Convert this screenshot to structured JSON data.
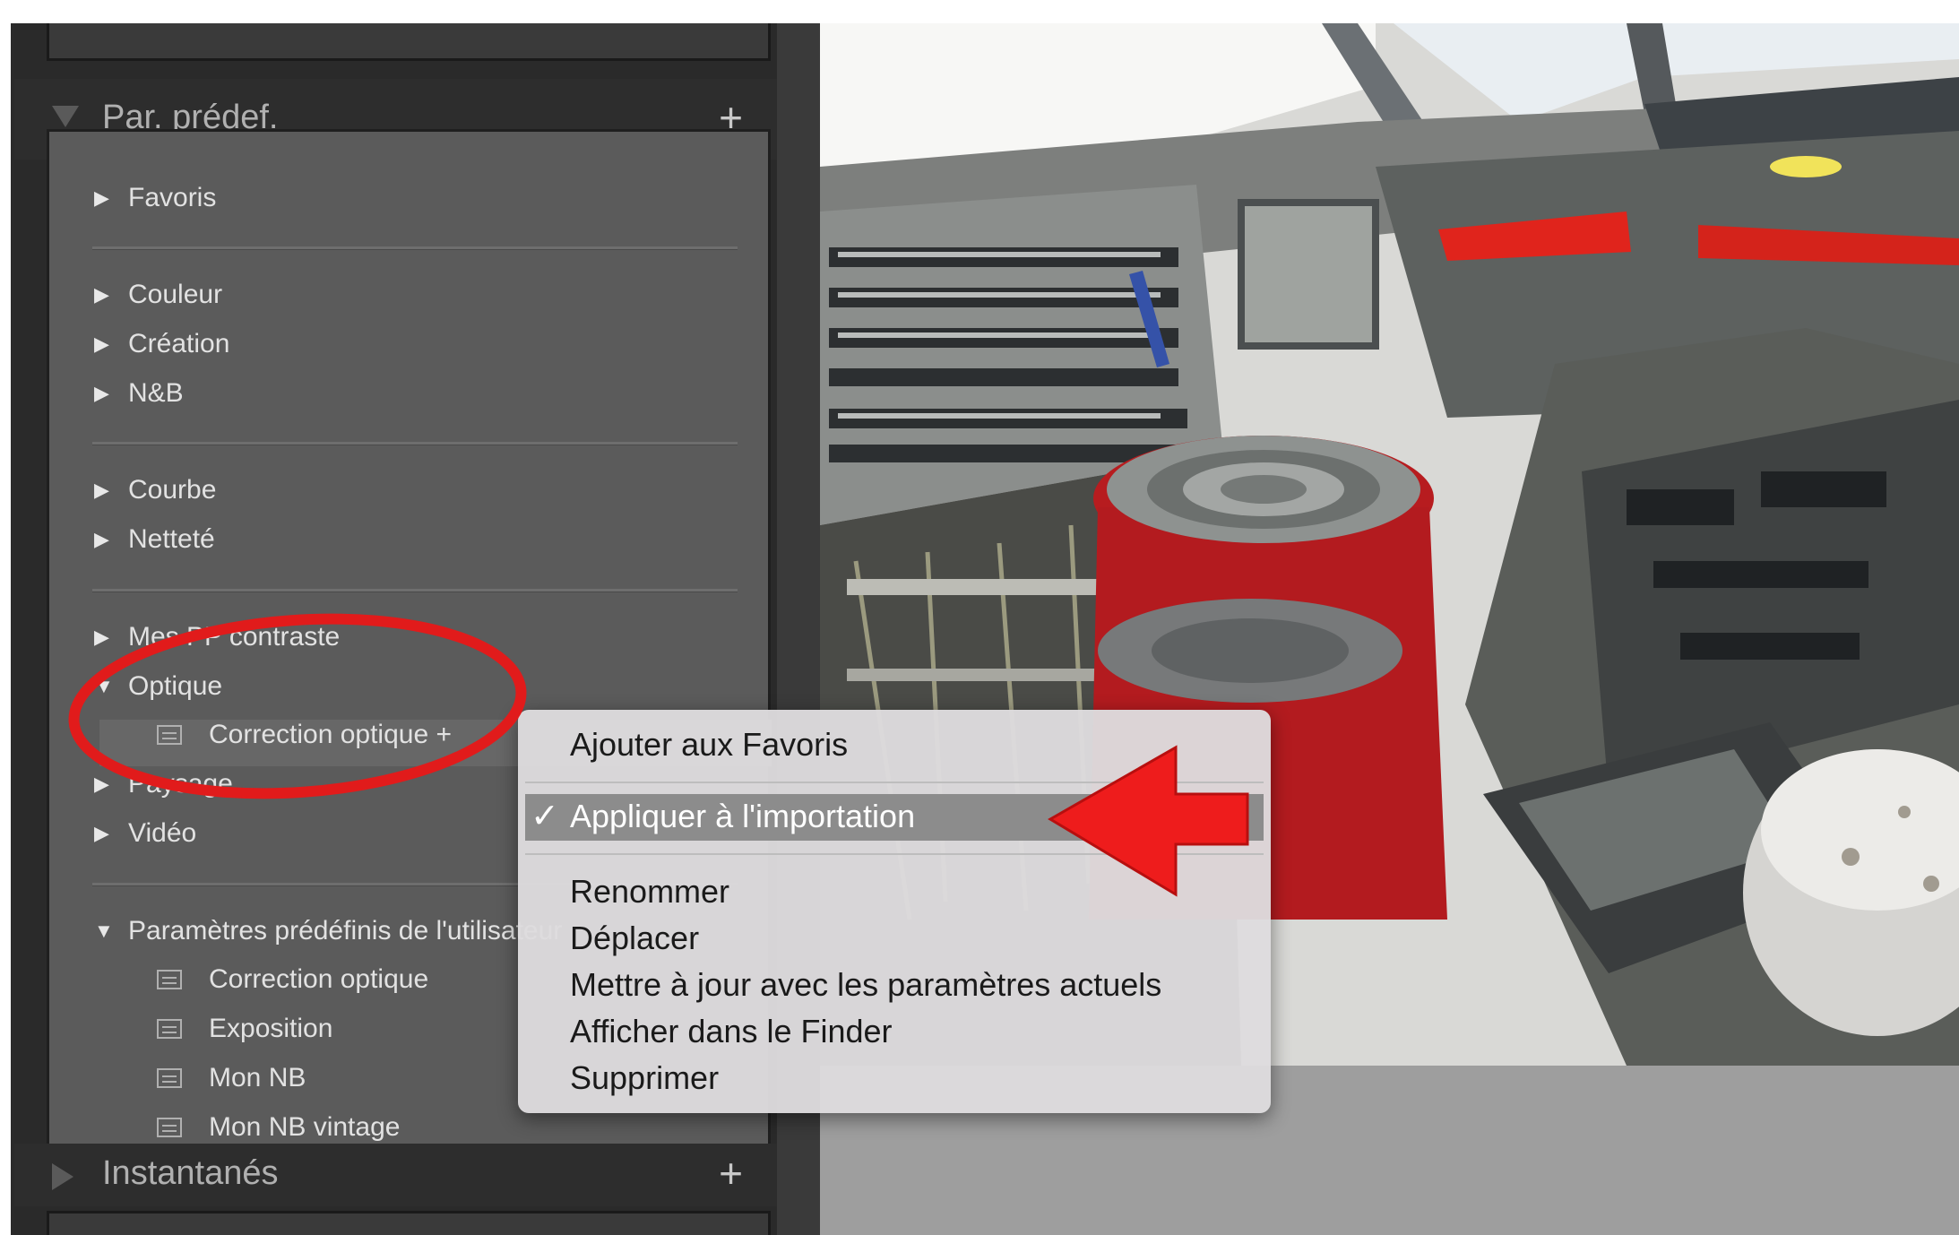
{
  "sidebar": {
    "presets_title": "Par. prédef.",
    "presets_add": "+",
    "groups": [
      {
        "label": "Favoris"
      },
      {
        "label": "Couleur"
      },
      {
        "label": "Création"
      },
      {
        "label": "N&B"
      },
      {
        "label": "Courbe"
      },
      {
        "label": "Netteté"
      },
      {
        "label": "Mes PP contraste"
      },
      {
        "label": "Optique"
      },
      {
        "label": "Paysage"
      },
      {
        "label": "Vidéo"
      },
      {
        "label": "Paramètres prédéfinis de l'utilisateur"
      }
    ],
    "optique_children": [
      {
        "label": "Correction optique +"
      }
    ],
    "user_presets": [
      {
        "label": "Correction optique"
      },
      {
        "label": "Exposition"
      },
      {
        "label": "Mon NB"
      },
      {
        "label": "Mon NB vintage"
      }
    ],
    "snapshots_title": "Instantanés",
    "snapshots_add": "+"
  },
  "context_menu": {
    "items": [
      {
        "label": "Ajouter aux Favoris"
      },
      {
        "label": "Appliquer à l'importation",
        "checked": true
      },
      {
        "label": "Renommer"
      },
      {
        "label": "Déplacer"
      },
      {
        "label": "Mettre à jour avec les paramètres actuels"
      },
      {
        "label": "Afficher dans le Finder"
      },
      {
        "label": "Supprimer"
      }
    ],
    "check_glyph": "✓"
  },
  "annotations": {
    "ellipse_color": "#e11b1b",
    "arrow_color": "#ee1c1c"
  },
  "photo": {
    "subject": "cockpit-photo"
  }
}
